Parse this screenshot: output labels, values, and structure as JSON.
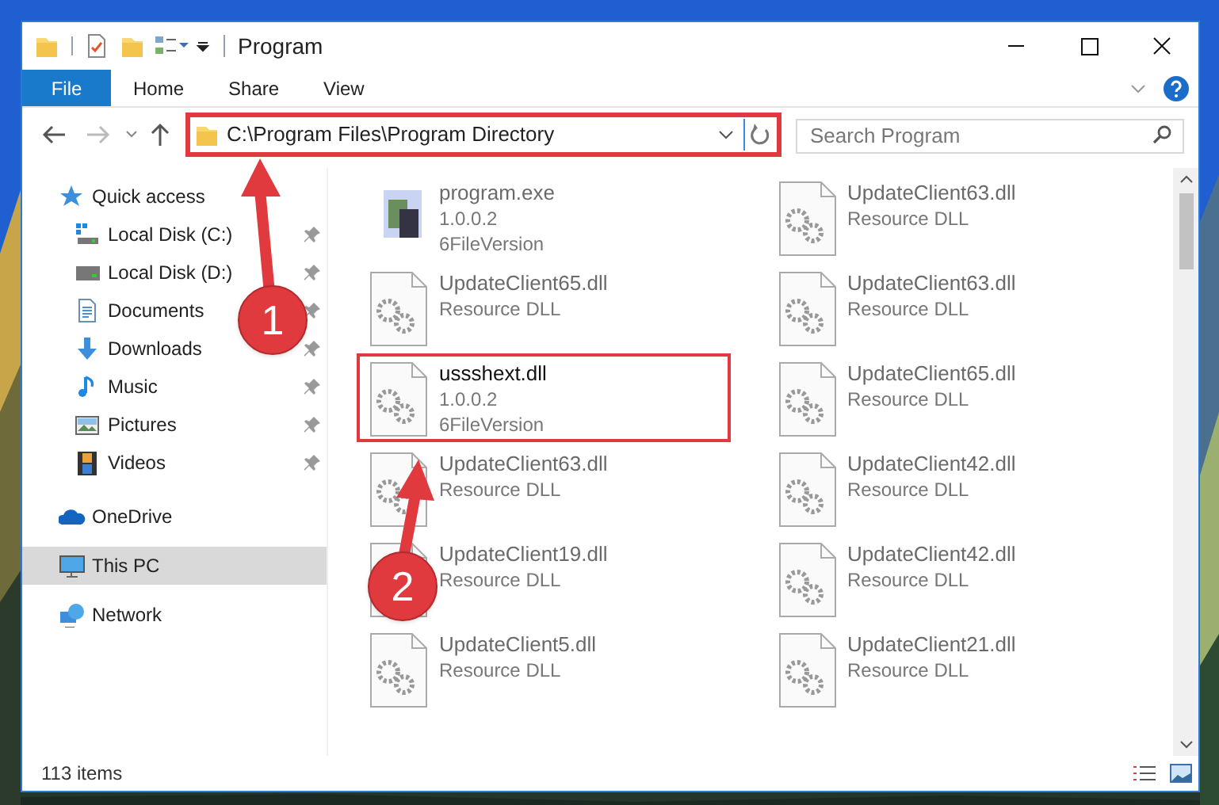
{
  "window": {
    "title": "Program"
  },
  "ribbon_tabs": [
    {
      "label": "File",
      "selected": true
    },
    {
      "label": "Home",
      "selected": false
    },
    {
      "label": "Share",
      "selected": false
    },
    {
      "label": "View",
      "selected": false
    }
  ],
  "address_bar": {
    "path": "C:\\Program Files\\Program Directory",
    "highlighted": true
  },
  "search": {
    "placeholder": "Search Program"
  },
  "navigation": [
    {
      "label": "Quick access",
      "selected": false,
      "children": [
        {
          "label": "Local Disk (C:)",
          "pinned": true,
          "selected": false
        },
        {
          "label": "Local Disk (D:)",
          "pinned": true,
          "selected": false
        },
        {
          "label": "Documents",
          "pinned": true,
          "selected": false
        },
        {
          "label": "Downloads",
          "pinned": true,
          "selected": false
        },
        {
          "label": "Music",
          "pinned": true,
          "selected": false
        },
        {
          "label": "Pictures",
          "pinned": true,
          "selected": false
        },
        {
          "label": "Videos",
          "pinned": true,
          "selected": false
        }
      ]
    },
    {
      "label": "OneDrive",
      "selected": false
    },
    {
      "label": "This PC",
      "selected": true
    },
    {
      "label": "Network",
      "selected": false
    }
  ],
  "files": [
    {
      "kind": "exe",
      "name": "program.exe",
      "lines": [
        "1.0.0.2",
        "6FileVersion"
      ],
      "blurred": true,
      "highlighted": false
    },
    {
      "kind": "dll",
      "name": "UpdateClient63.dll",
      "lines": [
        "Resource DLL"
      ],
      "blurred": true,
      "highlighted": false
    },
    {
      "kind": "dll",
      "name": "UpdateClient65.dll",
      "lines": [
        "Resource DLL"
      ],
      "blurred": true,
      "highlighted": false
    },
    {
      "kind": "dll",
      "name": "UpdateClient63.dll",
      "lines": [
        "Resource DLL"
      ],
      "blurred": true,
      "highlighted": false
    },
    {
      "kind": "dll",
      "name": "ussshext.dll",
      "lines": [
        "1.0.0.2",
        "6FileVersion"
      ],
      "blurred": false,
      "highlighted": true
    },
    {
      "kind": "dll",
      "name": "UpdateClient65.dll",
      "lines": [
        "Resource DLL"
      ],
      "blurred": true,
      "highlighted": false
    },
    {
      "kind": "dll",
      "name": "UpdateClient63.dll",
      "lines": [
        "Resource DLL"
      ],
      "blurred": true,
      "highlighted": false
    },
    {
      "kind": "dll",
      "name": "UpdateClient42.dll",
      "lines": [
        "Resource DLL"
      ],
      "blurred": true,
      "highlighted": false
    },
    {
      "kind": "dll",
      "name": "UpdateClient19.dll",
      "lines": [
        "Resource DLL"
      ],
      "blurred": true,
      "highlighted": false
    },
    {
      "kind": "dll",
      "name": "UpdateClient42.dll",
      "lines": [
        "Resource DLL"
      ],
      "blurred": true,
      "highlighted": false
    },
    {
      "kind": "dll",
      "name": "UpdateClient5.dll",
      "lines": [
        "Resource DLL"
      ],
      "blurred": true,
      "highlighted": false
    },
    {
      "kind": "dll",
      "name": "UpdateClient21.dll",
      "lines": [
        "Resource DLL"
      ],
      "blurred": true,
      "highlighted": false
    }
  ],
  "status_bar": {
    "item_count": "113 items"
  },
  "annotations": [
    {
      "number": "1"
    },
    {
      "number": "2"
    }
  ]
}
